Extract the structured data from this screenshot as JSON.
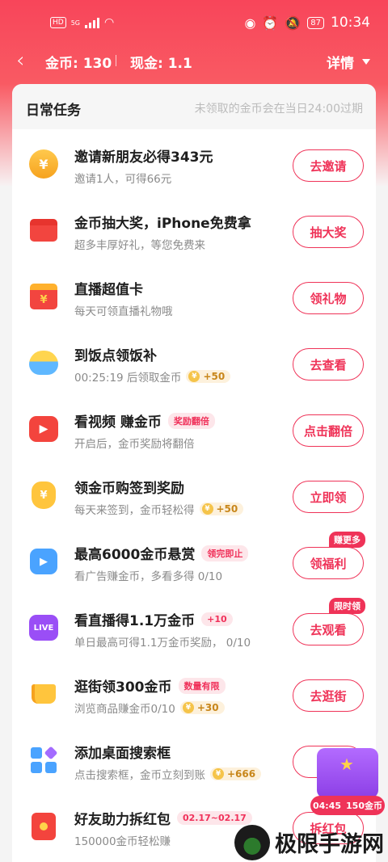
{
  "status": {
    "hd": "HD",
    "net": "5G",
    "battery": "87",
    "time": "10:34"
  },
  "nav": {
    "coins": "金币: 130",
    "cash": "现金: 1.1",
    "detail": "详情"
  },
  "section": {
    "title": "日常任务",
    "note": "未领取的金币会在当日24:00过期"
  },
  "tasks": [
    {
      "title": "邀请新朋友必得343元",
      "sub": "邀请1人，可得66元",
      "button": "去邀请",
      "icon": "coin-icon"
    },
    {
      "title": "金币抽大奖，iPhone免费拿",
      "sub": "超多丰厚好礼，等您免费来",
      "button": "抽大奖",
      "icon": "gift-box-icon"
    },
    {
      "title": "直播超值卡",
      "sub": "每天可领直播礼物哦",
      "button": "领礼物",
      "icon": "gift-card-icon"
    },
    {
      "title": "到饭点领饭补",
      "sub": "00:25:19 后领取金币",
      "coin": "+50",
      "button": "去查看",
      "icon": "rice-bowl-icon"
    },
    {
      "title": "看视频 赚金币",
      "tag": "奖励翻倍",
      "sub": "开启后，金币奖励将翻倍",
      "button": "点击翻倍",
      "icon": "video-play-icon"
    },
    {
      "title": "领金币购签到奖励",
      "sub": "每天来签到，金币轻松得",
      "coin": "+50",
      "button": "立即领",
      "icon": "money-bag-icon"
    },
    {
      "title": "最高6000金币悬赏",
      "tag": "领完即止",
      "sub": "看广告赚金币，多看多得 0/10",
      "button": "领福利",
      "badge": "赚更多",
      "icon": "ad-play-icon"
    },
    {
      "title": "看直播得1.1万金币",
      "tag": "+10",
      "sub": "单日最高可得1.1万金币奖励， 0/10",
      "button": "去观看",
      "badge": "限时领",
      "icon": "live-tv-icon"
    },
    {
      "title": "逛街领300金币",
      "tag": "数量有限",
      "sub": "浏览商品赚金币0/10",
      "coin": "+30",
      "button": "去逛街",
      "icon": "shopping-cart-icon"
    },
    {
      "title": "添加桌面搜索框",
      "sub": "点击搜索框，金币立刻到账",
      "coin": "+666",
      "button": "去",
      "icon": "widget-grid-icon"
    },
    {
      "title": "好友助力拆红包",
      "tag": "02.17~02.17",
      "sub": "150000金币轻松赚",
      "button": "拆红包",
      "icon": "red-packet-icon"
    }
  ],
  "float": {
    "time": "04:45",
    "reward": "150金币"
  },
  "watermark": {
    "text": "极限手游网"
  },
  "colors": {
    "accent": "#ef3358",
    "header": "#f8455a"
  }
}
